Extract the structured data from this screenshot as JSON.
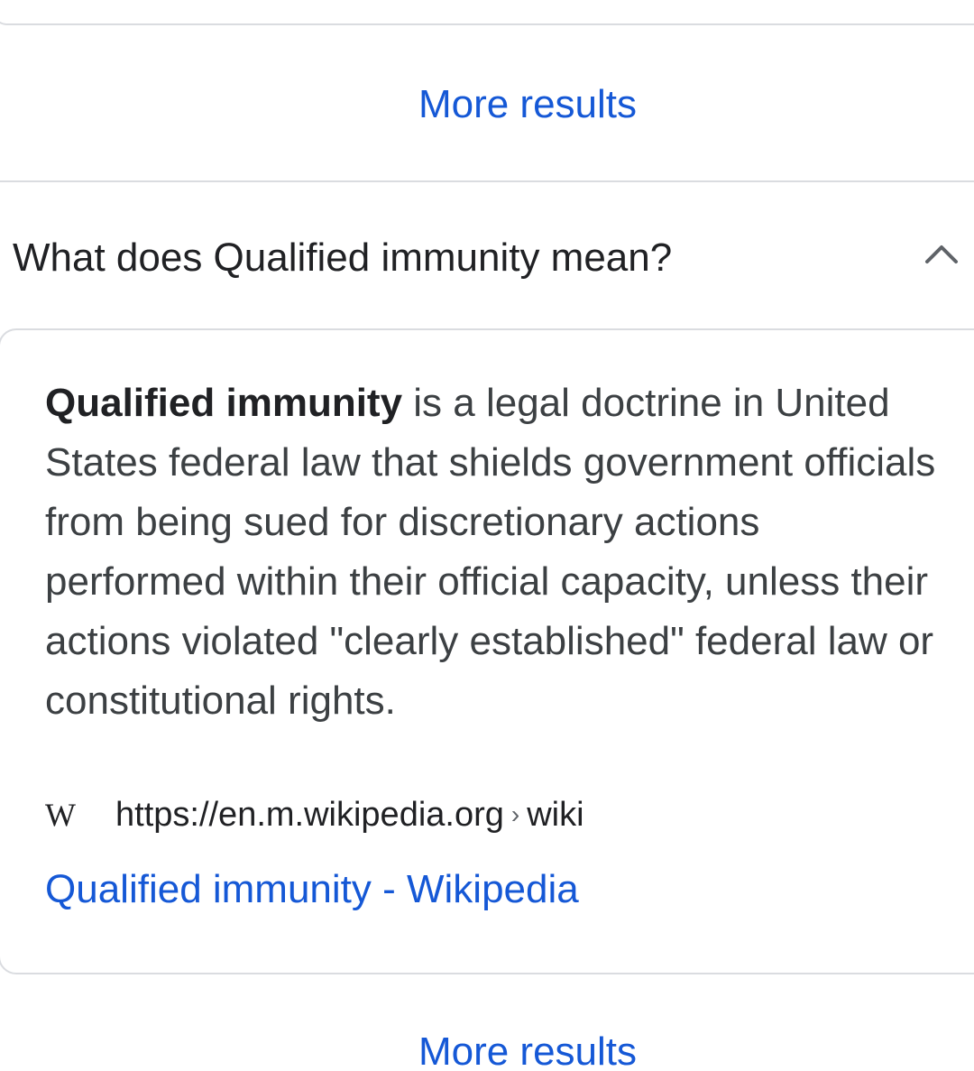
{
  "more_results_top": "More results",
  "question": "What does Qualified immunity mean?",
  "answer": {
    "bold_term": "Qualified immunity",
    "text": " is a legal doctrine in United States federal law that shields government officials from being sued for discretionary actions performed within their official capacity, unless their actions violated \"clearly established\" federal law or constitutional rights."
  },
  "source": {
    "icon_letter": "W",
    "url": "https://en.m.wikipedia.org",
    "separator": "›",
    "path": "wiki",
    "title": "Qualified immunity - Wikipedia"
  },
  "more_results_bottom": "More results",
  "colors": {
    "link": "#1558d6",
    "text": "#3c4043",
    "border": "#dadce0"
  },
  "icons": [
    "chevron-up-icon",
    "wikipedia-icon"
  ]
}
